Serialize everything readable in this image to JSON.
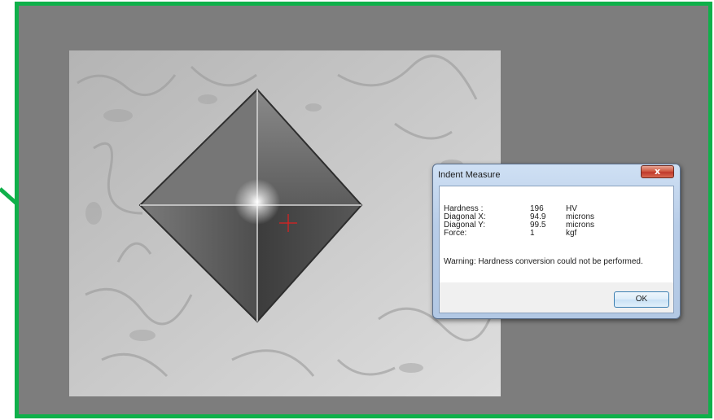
{
  "colors": {
    "frame_border": "#0fb04a",
    "frame_background": "#7d7d7d",
    "crosshair": "#e02020",
    "close_button": "#c0392b"
  },
  "image": {
    "description_icon": "vickers-indent-micrograph"
  },
  "dialog": {
    "title": "Indent Measure",
    "close_label": "x",
    "rows": [
      {
        "label": "Hardness  :",
        "value": "196",
        "unit": "HV"
      },
      {
        "label": "Diagonal X:",
        "value": "94.9",
        "unit": "microns"
      },
      {
        "label": "Diagonal Y:",
        "value": "99.5",
        "unit": "microns"
      },
      {
        "label": "Force:",
        "value": "1",
        "unit": "kgf"
      }
    ],
    "warning": "Warning: Hardness conversion could not be performed.",
    "ok_label": "OK"
  }
}
